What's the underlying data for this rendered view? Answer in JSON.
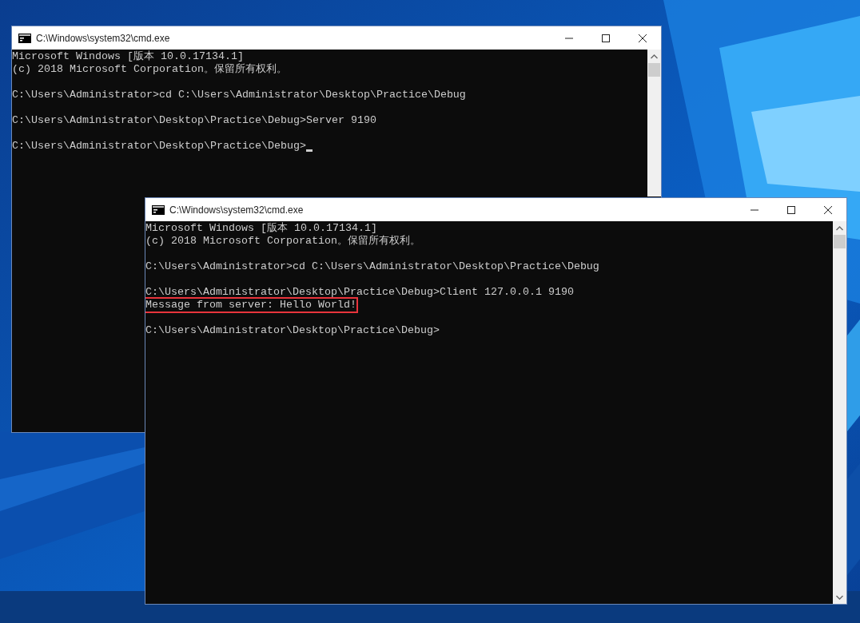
{
  "windows": [
    {
      "title": "C:\\Windows\\system32\\cmd.exe",
      "lines": [
        {
          "kind": "output",
          "text": "Microsoft Windows [版本 10.0.17134.1]",
          "highlighted": false,
          "cursor": false
        },
        {
          "kind": "output",
          "text": "(c) 2018 Microsoft Corporation。保留所有权利。",
          "highlighted": false,
          "cursor": false
        },
        {
          "kind": "blank"
        },
        {
          "kind": "output",
          "text": "C:\\Users\\Administrator>cd C:\\Users\\Administrator\\Desktop\\Practice\\Debug",
          "highlighted": false,
          "cursor": false
        },
        {
          "kind": "blank"
        },
        {
          "kind": "output",
          "text": "C:\\Users\\Administrator\\Desktop\\Practice\\Debug>Server 9190",
          "highlighted": false,
          "cursor": false
        },
        {
          "kind": "blank"
        },
        {
          "kind": "output",
          "text": "C:\\Users\\Administrator\\Desktop\\Practice\\Debug>",
          "highlighted": false,
          "cursor": true
        }
      ]
    },
    {
      "title": "C:\\Windows\\system32\\cmd.exe",
      "lines": [
        {
          "kind": "output",
          "text": "Microsoft Windows [版本 10.0.17134.1]",
          "highlighted": false,
          "cursor": false
        },
        {
          "kind": "output",
          "text": "(c) 2018 Microsoft Corporation。保留所有权利。",
          "highlighted": false,
          "cursor": false
        },
        {
          "kind": "blank"
        },
        {
          "kind": "output",
          "text": "C:\\Users\\Administrator>cd C:\\Users\\Administrator\\Desktop\\Practice\\Debug",
          "highlighted": false,
          "cursor": false
        },
        {
          "kind": "blank"
        },
        {
          "kind": "output",
          "text": "C:\\Users\\Administrator\\Desktop\\Practice\\Debug>Client 127.0.0.1 9190",
          "highlighted": false,
          "cursor": false
        },
        {
          "kind": "output",
          "text": "Message from server: Hello World!",
          "highlighted": true,
          "cursor": false
        },
        {
          "kind": "blank"
        },
        {
          "kind": "output",
          "text": "C:\\Users\\Administrator\\Desktop\\Practice\\Debug>",
          "highlighted": false,
          "cursor": false
        }
      ]
    }
  ]
}
